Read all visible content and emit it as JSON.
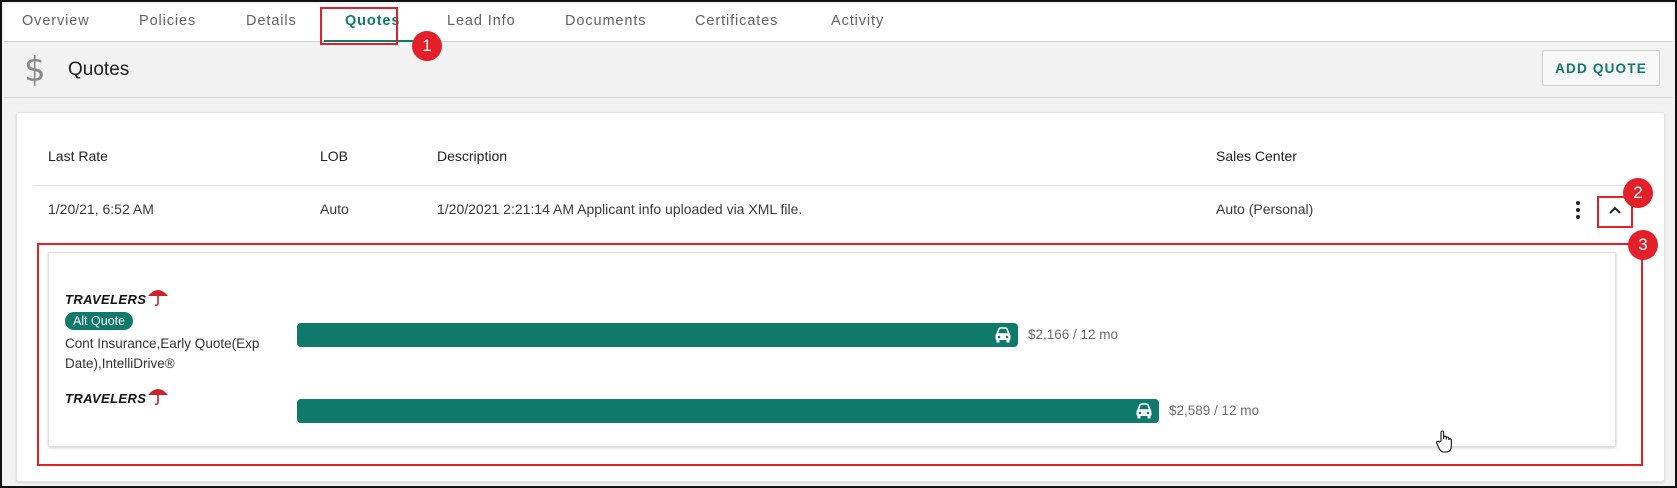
{
  "tabs": [
    {
      "label": "Overview"
    },
    {
      "label": "Policies"
    },
    {
      "label": "Details"
    },
    {
      "label": "Quotes"
    },
    {
      "label": "Lead Info"
    },
    {
      "label": "Documents"
    },
    {
      "label": "Certificates"
    },
    {
      "label": "Activity"
    }
  ],
  "active_tab": "Quotes",
  "header": {
    "icon": "dollar-icon",
    "title": "Quotes",
    "add_button": "ADD QUOTE"
  },
  "table": {
    "columns": [
      "Last Rate",
      "LOB",
      "Description",
      "Sales Center"
    ],
    "row": {
      "last_rate": "1/20/21, 6:52 AM",
      "lob": "Auto",
      "description": "1/20/2021 2:21:14 AM Applicant info uploaded via XML file.",
      "sales_center": "Auto (Personal)"
    }
  },
  "quotes": [
    {
      "carrier": "TRAVELERS",
      "badge": "Alt Quote",
      "description": "Cont Insurance,Early Quote(Exp Date),IntelliDrive®",
      "price": "$2,166 / 12 mo",
      "premium": 2166
    },
    {
      "carrier": "TRAVELERS",
      "price": "$2,589 / 12 mo",
      "premium": 2589
    }
  ],
  "annotations": [
    "1",
    "2",
    "3"
  ],
  "colors": {
    "accent": "#0f7a6c",
    "annotation": "#e3202a",
    "travelers_umbrella": "#d0202a"
  }
}
